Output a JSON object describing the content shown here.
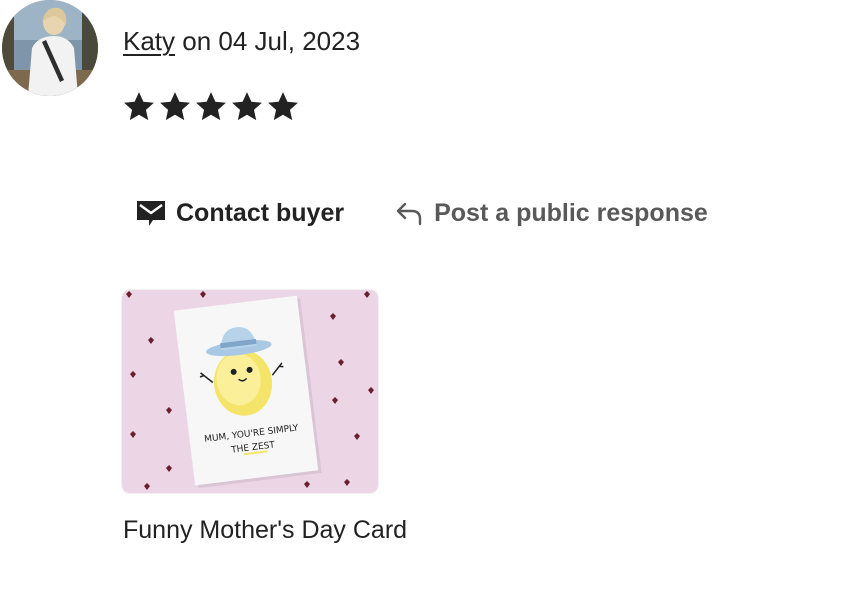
{
  "review": {
    "reviewer_name": "Katy",
    "date_text": " on 04 Jul, 2023",
    "rating": 5,
    "rating_max": 5
  },
  "actions": {
    "contact_label": "Contact buyer",
    "respond_label": "Post a public response"
  },
  "product": {
    "title": "Funny Mother's Day Card",
    "card_text_line1": "MUM, YOU'RE SIMPLY",
    "card_text_line2": "THE ZEST"
  },
  "colors": {
    "text": "#222222",
    "muted": "#595959",
    "thumb_background": "#ecd6e6"
  },
  "icons": {
    "star": "star-icon",
    "contact": "mail-chat-icon",
    "respond": "reply-arrow-icon"
  }
}
